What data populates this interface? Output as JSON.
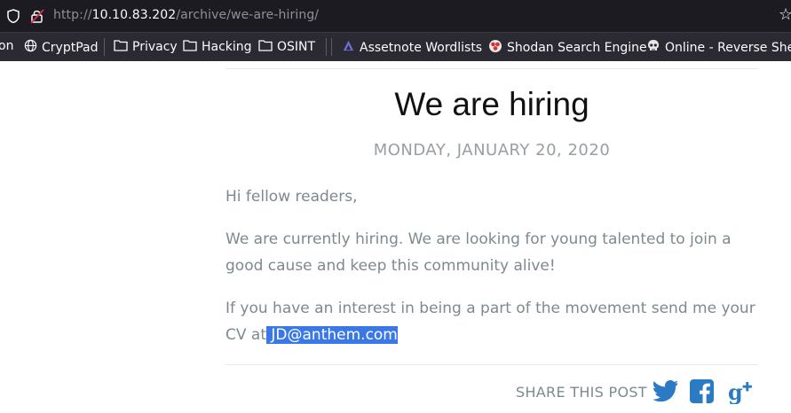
{
  "browser": {
    "url_prefix": "http://",
    "url_host": "10.10.83.202",
    "url_path": "/archive/we-are-hiring/"
  },
  "bookmarks": [
    {
      "label": "on"
    },
    {
      "label": "CryptPad"
    },
    {
      "label": "Privacy"
    },
    {
      "label": "Hacking"
    },
    {
      "label": "OSINT"
    },
    {
      "label": "Assetnote Wordlists"
    },
    {
      "label": "Shodan Search Engine"
    },
    {
      "label": "Online - Reverse Shel"
    }
  ],
  "post": {
    "title": "We are hiring",
    "date": "MONDAY, JANUARY 20, 2020",
    "greeting": "Hi fellow readers,",
    "paragraph1": "We are currently hiring. We are looking for young talented to join a good cause and keep this community alive!",
    "paragraph2_prefix": "If you have an interest in being a part of the movement send me your CV at",
    "email": " JD@anthem.com",
    "share_label": "SHARE THIS POST"
  },
  "colors": {
    "selection": "#3b78e7",
    "twitter": "#2a7bc4",
    "facebook": "#2a7bc4",
    "gplus": "#2a7bc4"
  }
}
